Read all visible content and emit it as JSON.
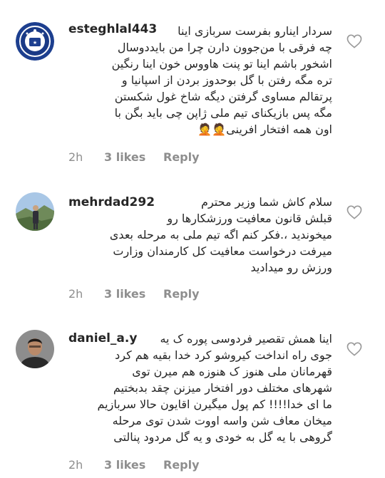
{
  "comments": [
    {
      "username": "esteghlal443",
      "text": "سردار اینارو بفرست سربازی اینا\nچه فرقی با من‌جوون دارن چرا من بایددوسال\nاشخور باشم اینا تو پنت هاووس خون اینا رنگین\nتره مگه رفتن با گل بوحدوز بردن از اسپانیا و\nپرتقالم مساوی گرفتن دیگه شاخ غول شکستن\nمگه پس بازیکنای تیم ملی ژاپن چی باید بگن با\nاون همه افتخار افرینی🤦🤦",
      "time": "2h",
      "likes": "3 likes",
      "reply": "Reply",
      "avatar_icon": "esteghlal-club-logo-avatar"
    },
    {
      "username": "mehrdad292",
      "text": "سلام کاش شما  وزیر محترم\nقبلش قانون معافیت ورزشکارها رو\nمیخوندید ،.فکر کنم اگه تیم ملی به مرحله بعدی\nمیرفت درخواست معافیت کل کارمندان وزارت\nورزش رو میدادید",
      "time": "2h",
      "likes": "3 likes",
      "reply": "Reply",
      "avatar_icon": "person-landscape-avatar"
    },
    {
      "username": "daniel_a.y",
      "text": "اینا همش تقصیر فردوسی پوره ک یه\nجوی راه انداخت کیروشو کرد خدا بقیه هم کرد\nقهرمانان ملی هنوز ک هنوزه هم میرن توی\nشهرهای مختلف دور افتخار میزنن چقد بدبختیم\nما ای خدا!!!! کم پول میگیرن اقایون حالا سربازیم\nمیخان معاف شن واسه اووت شدن توی مرحله\nگروهی با یه گل به خودی و یه گل مردود پنالتی",
      "time": "2h",
      "likes": "3 likes",
      "reply": "Reply",
      "avatar_icon": "person-portrait-avatar"
    }
  ],
  "colors": {
    "text": "#262626",
    "muted": "#8e8e8e",
    "heart_outline": "#999999",
    "club_blue": "#1d3f8f"
  },
  "icons": {
    "like": "heart-outline-icon"
  }
}
